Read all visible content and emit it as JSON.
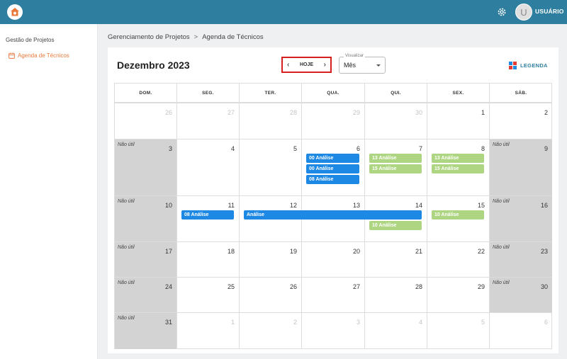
{
  "header": {
    "username": "USUÁRIO",
    "avatar_letter": "U",
    "colors": {
      "bar": "#2e7ea0",
      "accent": "#e8793a"
    }
  },
  "sidebar": {
    "section": "Gestão de Projetos",
    "item": "Agenda de Técnicos"
  },
  "breadcrumb": {
    "parent": "Gerenciamento de Projetos",
    "separator": ">",
    "current": "Agenda de Técnicos"
  },
  "calendar": {
    "title": "Dezembro 2023",
    "prev_icon": "chevron-left-icon",
    "next_icon": "chevron-right-icon",
    "today_label": "HOJE",
    "view_label": "Visualizar",
    "view_value": "Mês",
    "legend_label": "LEGENDA",
    "non_working_label": "Não útil",
    "weekdays": [
      "DOM.",
      "SEG.",
      "TER.",
      "QUA.",
      "QUI.",
      "SEX.",
      "SÁB."
    ],
    "weeks": [
      [
        "26",
        "27",
        "28",
        "29",
        "30",
        "1",
        "2"
      ],
      [
        "3",
        "4",
        "5",
        "6",
        "7",
        "8",
        "9"
      ],
      [
        "10",
        "11",
        "12",
        "13",
        "14",
        "15",
        "16"
      ],
      [
        "17",
        "18",
        "19",
        "20",
        "21",
        "22",
        "23"
      ],
      [
        "24",
        "25",
        "26",
        "27",
        "28",
        "29",
        "30"
      ],
      [
        "31",
        "1",
        "2",
        "3",
        "4",
        "5",
        "6"
      ]
    ],
    "events": [
      {
        "label": "00 Análise",
        "color": "blue"
      },
      {
        "label": "00 Análise",
        "color": "blue"
      },
      {
        "label": "08 Análise",
        "color": "blue"
      },
      {
        "label": "13 Análise",
        "color": "green"
      },
      {
        "label": "15 Análise",
        "color": "green"
      },
      {
        "label": "13 Análise",
        "color": "green"
      },
      {
        "label": "15 Análise",
        "color": "green"
      },
      {
        "label": "08 Análise",
        "color": "blue"
      },
      {
        "label": "Análise",
        "color": "blue"
      },
      {
        "label": "10 Análise",
        "color": "green"
      },
      {
        "label": "10 Análise",
        "color": "green"
      }
    ]
  }
}
